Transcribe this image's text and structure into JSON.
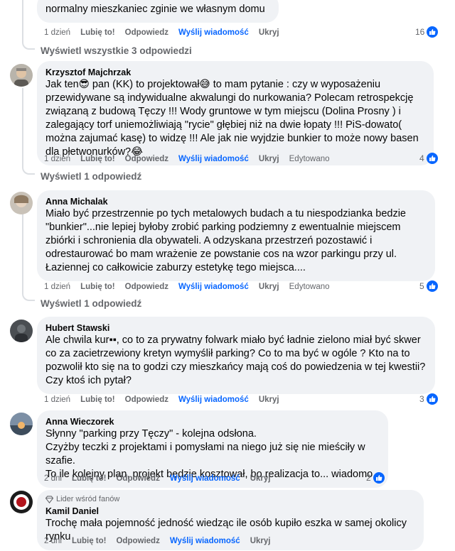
{
  "comments": [
    {
      "author": "",
      "text": "normalny mieszkaniec zginie we własnym domu",
      "time": "1 dzień",
      "like_label": "Lubię to!",
      "reply_label": "Odpowiedz",
      "send_label": "Wyślij wiadomość",
      "hide_label": "Ukryj",
      "edited_label": "",
      "reactions": "16"
    },
    {
      "author": "Krzysztof Majchrzak",
      "text": "Jak ten😎 pan (KK) to projektował😅 to mam pytanie : czy w wyposażeniu przewidywane są indywidualne akwalungi do nurkowania? Polecam retrospekcję związaną z budową Tęczy !!! Wody gruntowe w tym miejscu (Dolina Prosny ) i zalegający torf uniemożliwiają \"rycie\" głębiej niż na dwie łopaty !!! PiS-dowato( można zajumać kasę) to widzę !!! Ale jak nie wyjdzie bunkier to może nowy basen dla płetwonurków?😂",
      "time": "1 dzień",
      "like_label": "Lubię to!",
      "reply_label": "Odpowiedz",
      "send_label": "Wyślij wiadomość",
      "hide_label": "Ukryj",
      "edited_label": "Edytowano",
      "reactions": "4"
    },
    {
      "author": "Anna Michalak",
      "text": "Miało być przestrzennie po tych metalowych budach a tu niespodzianka bedzie \"bunkier\"...nie lepiej byłoby zrobić parking podziemny z ewentualnie miejscem zbiórki i schronienia dla obywateli. A odzyskana przestrzeń pozostawić i odrestaurować bo mam wrażenie ze powstanie cos na wzor parkingu przy ul. Łaziennej co całkowicie zaburzy estetykę tego miejsca....",
      "time": "1 dzień",
      "like_label": "Lubię to!",
      "reply_label": "Odpowiedz",
      "send_label": "Wyślij wiadomość",
      "hide_label": "Ukryj",
      "edited_label": "Edytowano",
      "reactions": "5"
    },
    {
      "author": "Hubert Stawski",
      "text": "Ale chwila kur▪▪, co to za prywatny folwark miało być ładnie zielono miał być skwer co za zacietrzewiony kretyn wymyślił parking? Co to ma być w ogóle ? Kto na to pozwolił kto się na to godzi czy mieszkańcy mają coś do powiedzenia w tej kwestii? Czy ktoś ich pytał?",
      "time": "1 dzień",
      "like_label": "Lubię to!",
      "reply_label": "Odpowiedz",
      "send_label": "Wyślij wiadomość",
      "hide_label": "Ukryj",
      "edited_label": "",
      "reactions": "3"
    },
    {
      "author": "Anna Wieczorek",
      "text": "Słynny \"parking przy Tęczy\" - kolejna odsłona.\nCzyżby teczki z projektami i pomysłami na niego już się nie mieściły w szafie.\nTo ile kolejny plan, projekt będzie kosztował, bo realizacja to... wiadomo.",
      "time": "2 dni",
      "like_label": "Lubię to!",
      "reply_label": "Odpowiedz",
      "send_label": "Wyślij wiadomość",
      "hide_label": "Ukryj",
      "edited_label": "",
      "reactions": "2"
    },
    {
      "author": "Kamil Daniel",
      "badge": "Lider wśród fanów",
      "text": "Trochę mała pojemność jedność wiedząc ile osób kupiło eszka w samej okolicy rynku",
      "time": "2 dni",
      "like_label": "Lubię to!",
      "reply_label": "Odpowiedz",
      "send_label": "Wyślij wiadomość",
      "hide_label": "Ukryj",
      "edited_label": "",
      "reactions": ""
    }
  ],
  "view_replies": [
    "Wyświetl wszystkie 3 odpowiedzi",
    "Wyświetl 1 odpowiedź",
    "Wyświetl 1 odpowiedź"
  ],
  "colors": {
    "bubble": "#f0f2f5",
    "link": "#0866ff",
    "muted": "#65676b"
  }
}
